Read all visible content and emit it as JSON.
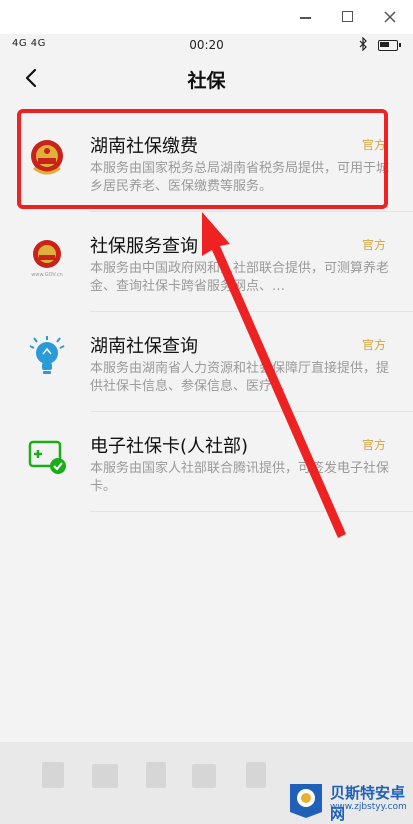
{
  "window": {
    "minimize": "minimize",
    "maximize": "maximize",
    "close": "close"
  },
  "status_bar": {
    "signal": "4G 4G",
    "time": "00:20"
  },
  "nav": {
    "title": "社保"
  },
  "items": [
    {
      "title": "湖南社保缴费",
      "desc": "本服务由国家税务总局湖南省税务局提供，可用于城乡居民养老、医保缴费等服务。",
      "badge": "官方",
      "icon": "national-emblem-icon"
    },
    {
      "title": "社保服务查询",
      "desc": "本服务由中国政府网和人社部联合提供，可测算养老金、查询社保卡跨省服务网点、…",
      "badge": "官方",
      "icon": "gov-emblem-icon"
    },
    {
      "title": "湖南社保查询",
      "desc": "本服务由湖南省人力资源和社会保障厅直接提供，提供社保卡信息、参保信息、医疗…",
      "badge": "官方",
      "icon": "lightbulb-icon"
    },
    {
      "title": "电子社保卡(人社部)",
      "desc": "本服务由国家人社部联合腾讯提供，可签发电子社保卡。",
      "badge": "官方",
      "icon": "social-card-icon"
    }
  ],
  "watermark": {
    "name": "贝斯特安卓网",
    "url": "www.zjbstyy.com"
  },
  "colors": {
    "highlight": "#ee2222",
    "badge": "#d9a540",
    "accent_green": "#1aad19"
  }
}
